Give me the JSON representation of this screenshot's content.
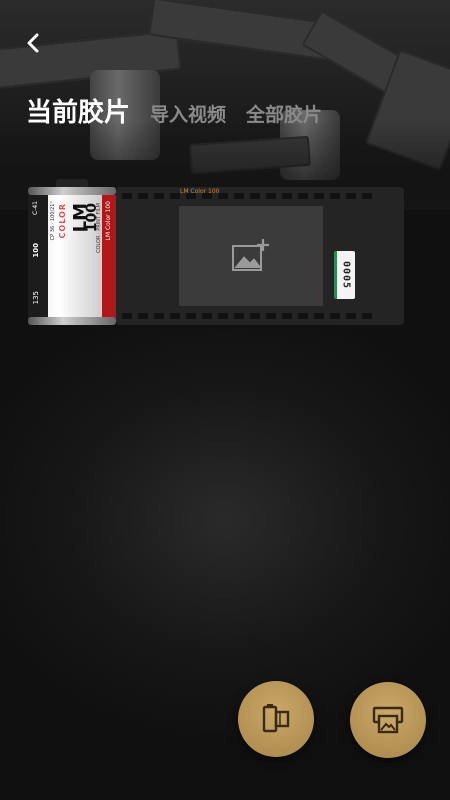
{
  "tabs": [
    {
      "label": "当前胶片",
      "active": true
    },
    {
      "label": "导入视频",
      "active": false
    },
    {
      "label": "全部胶片",
      "active": false
    }
  ],
  "film": {
    "strip_tag": "LM Color 100",
    "counter": "0005",
    "canister": {
      "brand": "LM",
      "speed": "100",
      "color_word": "COLOR",
      "band_text": "LM Color 100",
      "small_print": "COLOR · PRINT FILM",
      "side_code": "CP 36 · 100/21°",
      "exposures": "135",
      "iso_small": "100",
      "code": "C-41"
    }
  },
  "actions": {
    "film_icon": "film-roll-icon",
    "gallery_icon": "print-photo-icon"
  },
  "colors": {
    "accent_gold": "#b8955a",
    "counter_green": "#2e8b57",
    "red_band": "#b01818"
  }
}
